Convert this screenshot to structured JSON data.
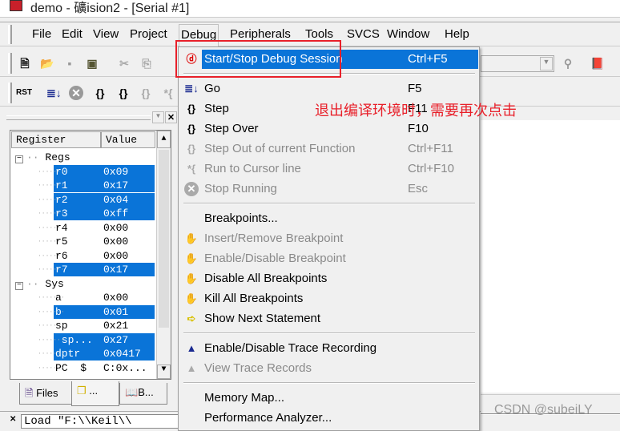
{
  "window": {
    "title": "demo  - 礦ision2 - [Serial #1]"
  },
  "menubar": [
    "File",
    "Edit",
    "View",
    "Project",
    "Debug",
    "Peripherals",
    "Tools",
    "SVCS",
    "Window",
    "Help"
  ],
  "panel": {
    "columns": [
      "Register",
      "Value"
    ],
    "groups": [
      {
        "name": "Regs",
        "items": [
          {
            "name": "r0",
            "value": "0x09",
            "selected": true
          },
          {
            "name": "r1",
            "value": "0x17",
            "selected": true
          },
          {
            "name": "r2",
            "value": "0x04",
            "selected": true
          },
          {
            "name": "r3",
            "value": "0xff",
            "selected": true
          },
          {
            "name": "r4",
            "value": "0x00",
            "selected": false
          },
          {
            "name": "r5",
            "value": "0x00",
            "selected": false
          },
          {
            "name": "r6",
            "value": "0x00",
            "selected": false
          },
          {
            "name": "r7",
            "value": "0x17",
            "selected": true
          }
        ]
      },
      {
        "name": "Sys",
        "items": [
          {
            "name": "a",
            "value": "0x00",
            "selected": false
          },
          {
            "name": "b",
            "value": "0x01",
            "selected": true
          },
          {
            "name": "sp",
            "value": "0x21",
            "selected": false
          },
          {
            "name": " sp...",
            "value": "0x27",
            "selected": true
          },
          {
            "name": "dptr",
            "value": "0x0417",
            "selected": true
          },
          {
            "name": "PC  $",
            "value": "C:0x...",
            "selected": false
          }
        ]
      }
    ],
    "tabs": [
      "Files",
      "...",
      "B..."
    ]
  },
  "output": {
    "text": "Load \"F:\\\\Keil\\\\"
  },
  "debug_menu": [
    {
      "label": "Start/Stop Debug Session",
      "shortcut": "Ctrl+F5",
      "icon": "debug-session-icon",
      "enabled": true,
      "highlighted": true
    },
    {
      "sep": true
    },
    {
      "label": "Go",
      "shortcut": "F5",
      "icon": "go-icon",
      "enabled": true
    },
    {
      "label": "Step",
      "shortcut": "F11",
      "icon": "step-icon",
      "enabled": true
    },
    {
      "label": "Step Over",
      "shortcut": "F10",
      "icon": "step-over-icon",
      "enabled": true
    },
    {
      "label": "Step Out of current Function",
      "shortcut": "Ctrl+F11",
      "icon": "step-out-icon",
      "enabled": false
    },
    {
      "label": "Run to Cursor line",
      "shortcut": "Ctrl+F10",
      "icon": "run-to-cursor-icon",
      "enabled": false
    },
    {
      "label": "Stop Running",
      "shortcut": "Esc",
      "icon": "stop-icon",
      "enabled": false
    },
    {
      "sep": true
    },
    {
      "label": "Breakpoints...",
      "shortcut": "",
      "icon": "",
      "enabled": true
    },
    {
      "label": "Insert/Remove Breakpoint",
      "shortcut": "",
      "icon": "hand-icon",
      "enabled": false
    },
    {
      "label": "Enable/Disable Breakpoint",
      "shortcut": "",
      "icon": "hand-toggle-icon",
      "enabled": false
    },
    {
      "label": "Disable All Breakpoints",
      "shortcut": "",
      "icon": "hand-disable-icon",
      "enabled": true
    },
    {
      "label": "Kill All Breakpoints",
      "shortcut": "",
      "icon": "hand-kill-icon",
      "enabled": true
    },
    {
      "label": "Show Next Statement",
      "shortcut": "",
      "icon": "arrow-right-icon",
      "enabled": true
    },
    {
      "sep": true
    },
    {
      "label": "Enable/Disable Trace Recording",
      "shortcut": "",
      "icon": "rec-icon",
      "enabled": true
    },
    {
      "label": "View Trace Records",
      "shortcut": "",
      "icon": "trace-icon",
      "enabled": false
    },
    {
      "sep": true
    },
    {
      "label": "Memory Map...",
      "shortcut": "",
      "icon": "",
      "enabled": true
    },
    {
      "label": "Performance Analyzer...",
      "shortcut": "",
      "icon": "",
      "enabled": true
    }
  ],
  "annotation": "退出编译环境时，需要再次点击",
  "watermark": "CSDN @subeiLY",
  "colors": {
    "highlight": "#0a74d8",
    "annotation": "#e8202a"
  }
}
